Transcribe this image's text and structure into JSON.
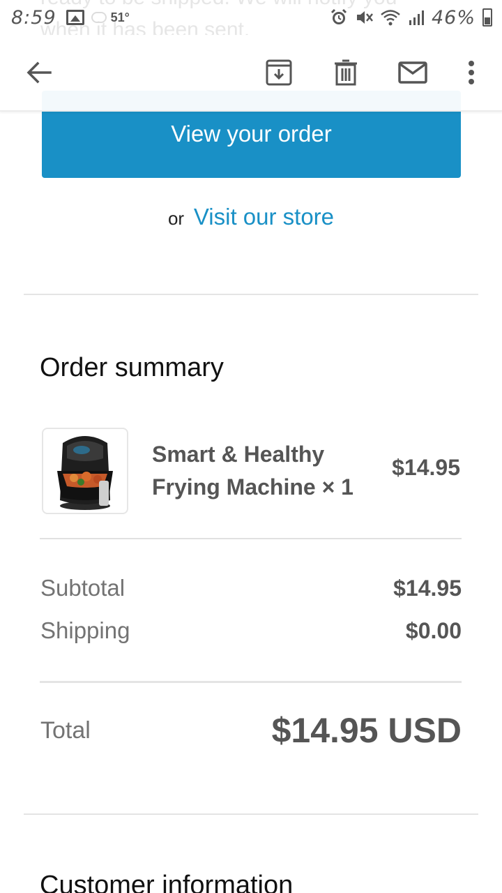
{
  "status_bar": {
    "time": "8:59",
    "temperature": "51°",
    "battery_percent": "46%",
    "icons": [
      "image-icon",
      "weather-icon",
      "alarm-icon",
      "mute-icon",
      "wifi-icon",
      "signal-icon",
      "battery-icon"
    ]
  },
  "email_ghost_text": {
    "line1": "ready to be shipped. We will notify you",
    "line2": "when it has been sent."
  },
  "app_bar": {
    "icons": [
      "back-arrow-icon",
      "archive-icon",
      "delete-icon",
      "mail-icon",
      "more-vert-icon"
    ]
  },
  "actions": {
    "view_order_label": "View your order",
    "or_text": "or",
    "visit_store_label": "Visit our store"
  },
  "order_summary": {
    "title": "Order summary",
    "items": [
      {
        "name": "Smart & Healthy Frying Machine × 1",
        "price": "$14.95",
        "image": "air-fryer-image"
      }
    ],
    "subtotal_label": "Subtotal",
    "subtotal_value": "$14.95",
    "shipping_label": "Shipping",
    "shipping_value": "$0.00",
    "total_label": "Total",
    "total_value": "$14.95 USD"
  },
  "customer_information": {
    "title": "Customer information"
  },
  "colors": {
    "accent": "#1990c6",
    "text_muted": "#737373",
    "text_value": "#555555"
  }
}
